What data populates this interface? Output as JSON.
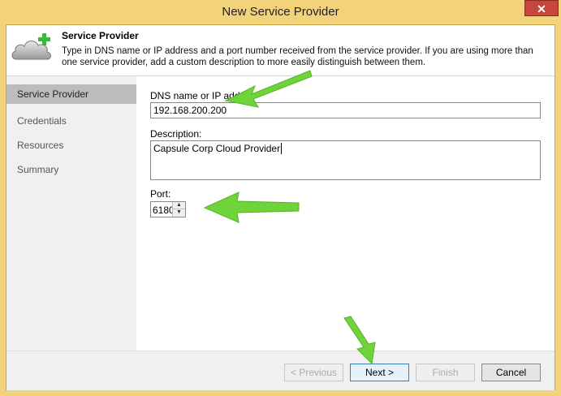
{
  "window": {
    "title": "New Service Provider",
    "close_glyph": "✕"
  },
  "header": {
    "title": "Service Provider",
    "description": "Type in DNS name or IP address and a port number received from the service provider. If you are using more than one service provider, add a custom description to more easily distinguish between them.",
    "icon": "cloud-add-icon"
  },
  "sidebar": {
    "items": [
      {
        "label": "Service Provider"
      },
      {
        "label": "Credentials"
      },
      {
        "label": "Resources"
      },
      {
        "label": "Summary"
      }
    ]
  },
  "form": {
    "dns_label": "DNS name or IP addre",
    "dns_value": "192.168.200.200",
    "description_label": "Description:",
    "description_value": "Capsule Corp Cloud Provider",
    "port_label": "Port:",
    "port_value": "6180"
  },
  "footer": {
    "previous_label": "< Previous",
    "next_label": "Next >",
    "finish_label": "Finish",
    "cancel_label": "Cancel"
  },
  "colors": {
    "frame": "#f2d27a",
    "close": "#c7463b",
    "arrow": "#6fd43a",
    "selected_nav": "#bcbcbc"
  }
}
